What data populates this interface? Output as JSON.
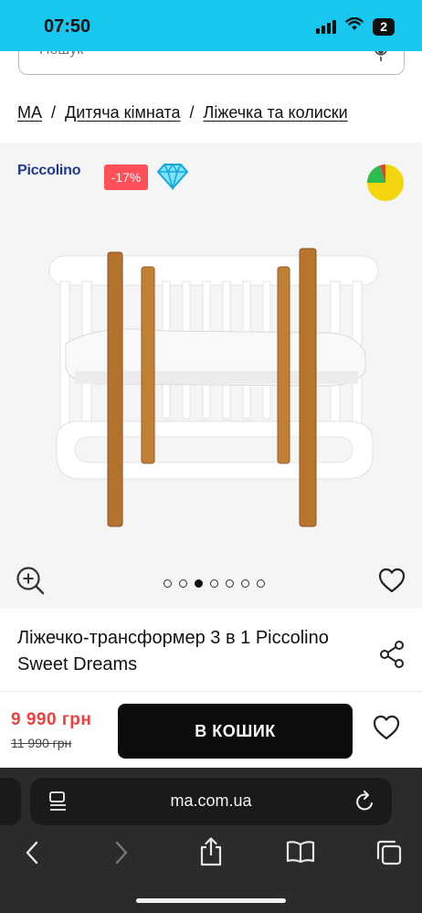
{
  "status_bar": {
    "time": "07:50",
    "battery": "2"
  },
  "search": {
    "placeholder": "Пошук"
  },
  "breadcrumb": [
    {
      "label": "МА"
    },
    {
      "label": "Дитяча кімната"
    },
    {
      "label": "Ліжечка та колиски"
    }
  ],
  "breadcrumb_separator": "/",
  "gallery": {
    "brand": "Piccolino",
    "discount": "-17%",
    "image_count": 7,
    "active_image": 3
  },
  "product": {
    "title": "Ліжечко-трансформер 3 в 1 Piccolino Sweet Dreams"
  },
  "buy_bar": {
    "price": "9 990 грн",
    "old_price": "11 990 грн",
    "cart_label": "В КОШИК"
  },
  "browser": {
    "address": "ma.com.ua"
  },
  "colors": {
    "status_bar": "#17c7ee",
    "discount": "#ff4f57",
    "price": "#f23d3d",
    "brand": "#1f3a8f",
    "button": "#0c0c0c",
    "browser": "#2b2b2d"
  },
  "icons": [
    "signal-icon",
    "wifi-icon",
    "battery-icon",
    "mic-icon",
    "diamond-icon",
    "pie-icon",
    "zoom-icon",
    "heart-icon",
    "share-icon",
    "reader-icon",
    "reload-icon",
    "back-icon",
    "forward-icon",
    "share-sheet-icon",
    "bookmarks-icon",
    "tabs-icon"
  ]
}
